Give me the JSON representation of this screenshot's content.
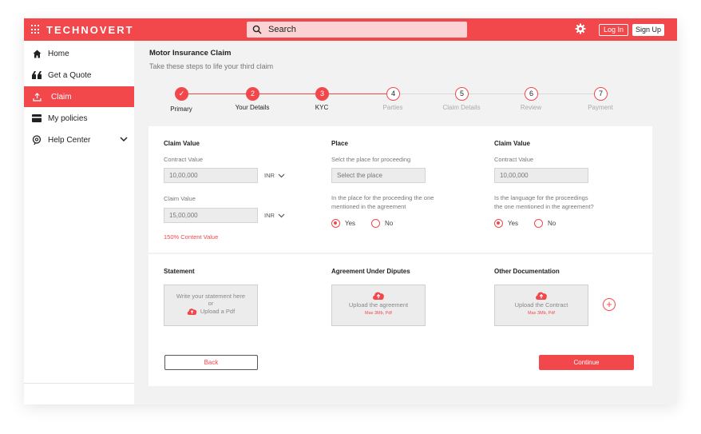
{
  "app": {
    "brand": "TECHNOVERT"
  },
  "header": {
    "search_placeholder": "Search",
    "login_label": "Log In",
    "signup_label": "Sign Up",
    "icons": [
      "grid-icon",
      "search-icon",
      "gear-icon"
    ]
  },
  "sidebar": {
    "items": [
      {
        "label": "Home",
        "icon": "home-icon",
        "active": false
      },
      {
        "label": "Get a Quote",
        "icon": "quote-icon",
        "active": false
      },
      {
        "label": "Claim",
        "icon": "upload-icon",
        "active": true
      },
      {
        "label": "My policies",
        "icon": "card-icon",
        "active": false
      },
      {
        "label": "Help Center",
        "icon": "help-icon",
        "active": false,
        "expandable": true
      }
    ]
  },
  "page": {
    "title": "Motor Insurance Claim",
    "subtitle": "Take these steps to life your third claim"
  },
  "stepper": {
    "steps": [
      {
        "number": "✓",
        "label": "Primary",
        "done": true
      },
      {
        "number": "2",
        "label": "Your Details",
        "done": true
      },
      {
        "number": "3",
        "label": "KYC",
        "done": true
      },
      {
        "number": "4",
        "label": "Parties",
        "done": false
      },
      {
        "number": "5",
        "label": "Claim Details",
        "done": false
      },
      {
        "number": "6",
        "label": "Review",
        "done": false
      },
      {
        "number": "7",
        "label": "Payment",
        "done": false
      }
    ]
  },
  "form": {
    "col1": {
      "heading": "Claim Value",
      "contract_label": "Contract Value",
      "contract_value": "10,00,000",
      "contract_unit": "INR",
      "claim_label": "Claim Value",
      "claim_value": "15,00,000",
      "claim_unit": "INR",
      "note": "150% Content Value"
    },
    "col2": {
      "heading": "Place",
      "place_label": "Selct the place for proceeding",
      "place_placeholder": "Select the place",
      "question_line1": "In the place for the proceeding the one",
      "question_line2": "mentioned in the agreement",
      "yes": "Yes",
      "no": "No",
      "selected": "Yes"
    },
    "col3": {
      "heading": "Claim Value",
      "contract_label": "Contract Value",
      "contract_value": "10,00,000",
      "question_line1": "Is the language for the proceedings",
      "question_line2": "the one mentioned in the agreement?",
      "yes": "Yes",
      "no": "No",
      "selected": "Yes"
    }
  },
  "documents": {
    "statement": {
      "heading": "Statement",
      "line1": "Write  your statement here",
      "line2": "or",
      "line3": "Upload a Pdf"
    },
    "agreement": {
      "heading": "Agreement Under Diputes",
      "upload_text": "Upload the agreement",
      "max_text": "Max 3Mb, Pdf"
    },
    "other": {
      "heading": "Other  Documentation",
      "upload_text": "Upload the Contract",
      "max_text": "Max 3Mb, Pdf",
      "add_label": "+"
    }
  },
  "actions": {
    "back_label": "Back",
    "continue_label": "Continue"
  },
  "colors": {
    "accent": "#f2484c",
    "background": "#f2f2f2"
  }
}
